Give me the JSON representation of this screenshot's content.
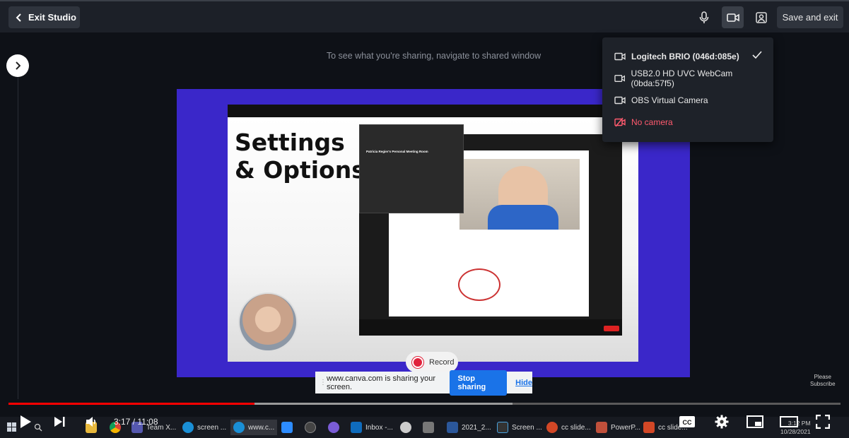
{
  "topbar": {
    "exit_label": "Exit Studio",
    "save_label": "Save and exit"
  },
  "hint": "To see what you're sharing, navigate to shared window",
  "camera_menu": {
    "items": [
      {
        "label": "Logitech BRIO (046d:085e)",
        "selected": true
      },
      {
        "label": "USB2.0 HD UVC WebCam (0bda:57f5)",
        "selected": false
      },
      {
        "label": "OBS Virtual Camera",
        "selected": false
      },
      {
        "label": "No camera",
        "selected": false
      }
    ]
  },
  "slide": {
    "title": "Settings\n& Options",
    "meeting_room_title": "Patricia Regier's Personal Meeting Room"
  },
  "record": {
    "label": "Record"
  },
  "sharing_bar": {
    "message": "www.canva.com is sharing your screen.",
    "stop_label": "Stop sharing",
    "hide_label": "Hide"
  },
  "subscribe": "Please\nSubscribe",
  "player": {
    "time": "3:17 / 11:08",
    "progress_played": 0.296,
    "progress_buffered": 0.606
  },
  "taskbar": {
    "apps": [
      "Team X...",
      "screen ...",
      "www.c...",
      "Inbox -...",
      "2021_2...",
      "Screen ...",
      "cc slide...",
      "PowerP...",
      "cc slide..."
    ],
    "clock_time": "3:12 PM",
    "clock_date": "10/28/2021"
  },
  "colors": {
    "accent_red": "#e0223b",
    "share_frame": "#3a27c9",
    "stop_button": "#1a73e8",
    "progress": "#ff0000"
  }
}
